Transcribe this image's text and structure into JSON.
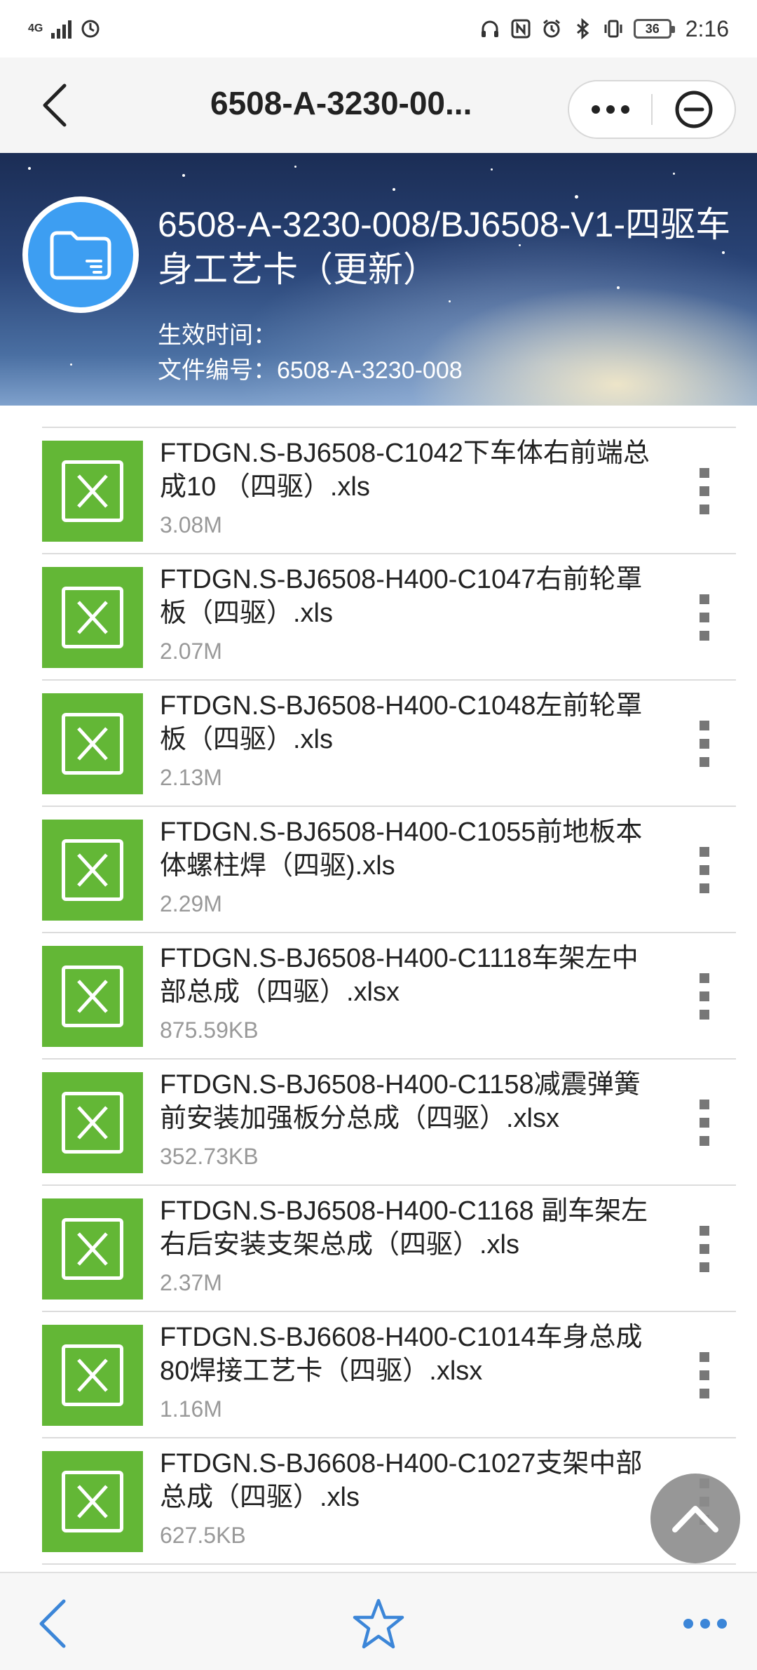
{
  "status_bar": {
    "network": "4G",
    "battery": "36",
    "time": "2:16"
  },
  "header": {
    "title": "6508-A-3230-00...",
    "more_icon": "more-dots-icon",
    "close_icon": "minus-circle-icon"
  },
  "folder": {
    "title": "6508-A-3230-008/BJ6508-V1-四驱车身工艺卡（更新）",
    "effective_time": "生效时间：",
    "file_number": "文件编号：6508-A-3230-008"
  },
  "files": [
    {
      "name": "FTDGN.S-BJ6508-C1042下车体右前端总成10 （四驱）.xls",
      "size": "3.08M"
    },
    {
      "name": "FTDGN.S-BJ6508-H400-C1047右前轮罩板（四驱）.xls",
      "size": "2.07M"
    },
    {
      "name": "FTDGN.S-BJ6508-H400-C1048左前轮罩板（四驱）.xls",
      "size": "2.13M"
    },
    {
      "name": "FTDGN.S-BJ6508-H400-C1055前地板本体螺柱焊（四驱).xls",
      "size": "2.29M"
    },
    {
      "name": "FTDGN.S-BJ6508-H400-C1118车架左中部总成（四驱）.xlsx",
      "size": "875.59KB"
    },
    {
      "name": "FTDGN.S-BJ6508-H400-C1158减震弹簧前安装加强板分总成（四驱）.xlsx",
      "size": "352.73KB"
    },
    {
      "name": "FTDGN.S-BJ6508-H400-C1168 副车架左右后安装支架总成（四驱）.xls",
      "size": "2.37M"
    },
    {
      "name": "FTDGN.S-BJ6608-H400-C1014车身总成80焊接工艺卡（四驱）.xlsx",
      "size": "1.16M"
    },
    {
      "name": "FTDGN.S-BJ6608-H400-C1027支架中部总成（四驱）.xls",
      "size": "627.5KB"
    }
  ],
  "colors": {
    "xls_green": "#63b736",
    "folder_blue": "#3d9ef2",
    "accent_blue": "#3c86d8"
  },
  "bottom_bar": {
    "back_icon": "back-arrow-icon",
    "favorite_icon": "star-icon",
    "more_icon": "more-dots-icon"
  }
}
